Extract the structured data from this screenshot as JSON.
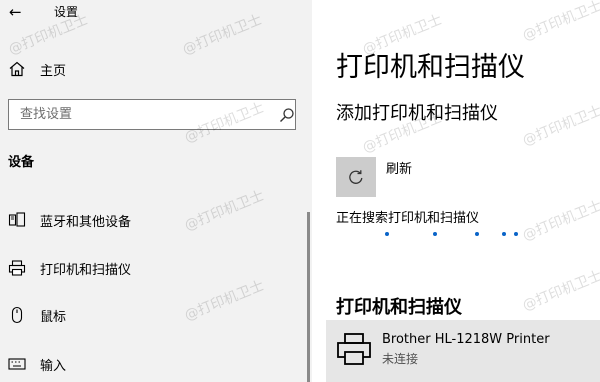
{
  "window": {
    "back_glyph": "←",
    "title": "设置"
  },
  "sidebar": {
    "home_label": "主页",
    "search": {
      "placeholder": "查找设置",
      "value": ""
    },
    "section": "设备",
    "items": [
      {
        "label": "蓝牙和其他设备",
        "icon": "bluetooth-devices-icon"
      },
      {
        "label": "打印机和扫描仪",
        "icon": "printer-icon"
      },
      {
        "label": "鼠标",
        "icon": "mouse-icon"
      },
      {
        "label": "输入",
        "icon": "keyboard-icon"
      }
    ]
  },
  "main": {
    "title": "打印机和扫描仪",
    "add_heading": "添加打印机和扫描仪",
    "refresh_label": "刷新",
    "search_status": "正在搜索打印机和扫描仪",
    "list_heading": "打印机和扫描仪",
    "printers": [
      {
        "name": "Brother HL-1218W Printer",
        "status": "未连接"
      }
    ]
  },
  "watermark": "@打印机卫士",
  "colors": {
    "sidebar_bg": "#f2f2f2",
    "accent": "#0a64c8",
    "selected_row": "#e6e6e6",
    "button_bg": "#cccccc"
  }
}
